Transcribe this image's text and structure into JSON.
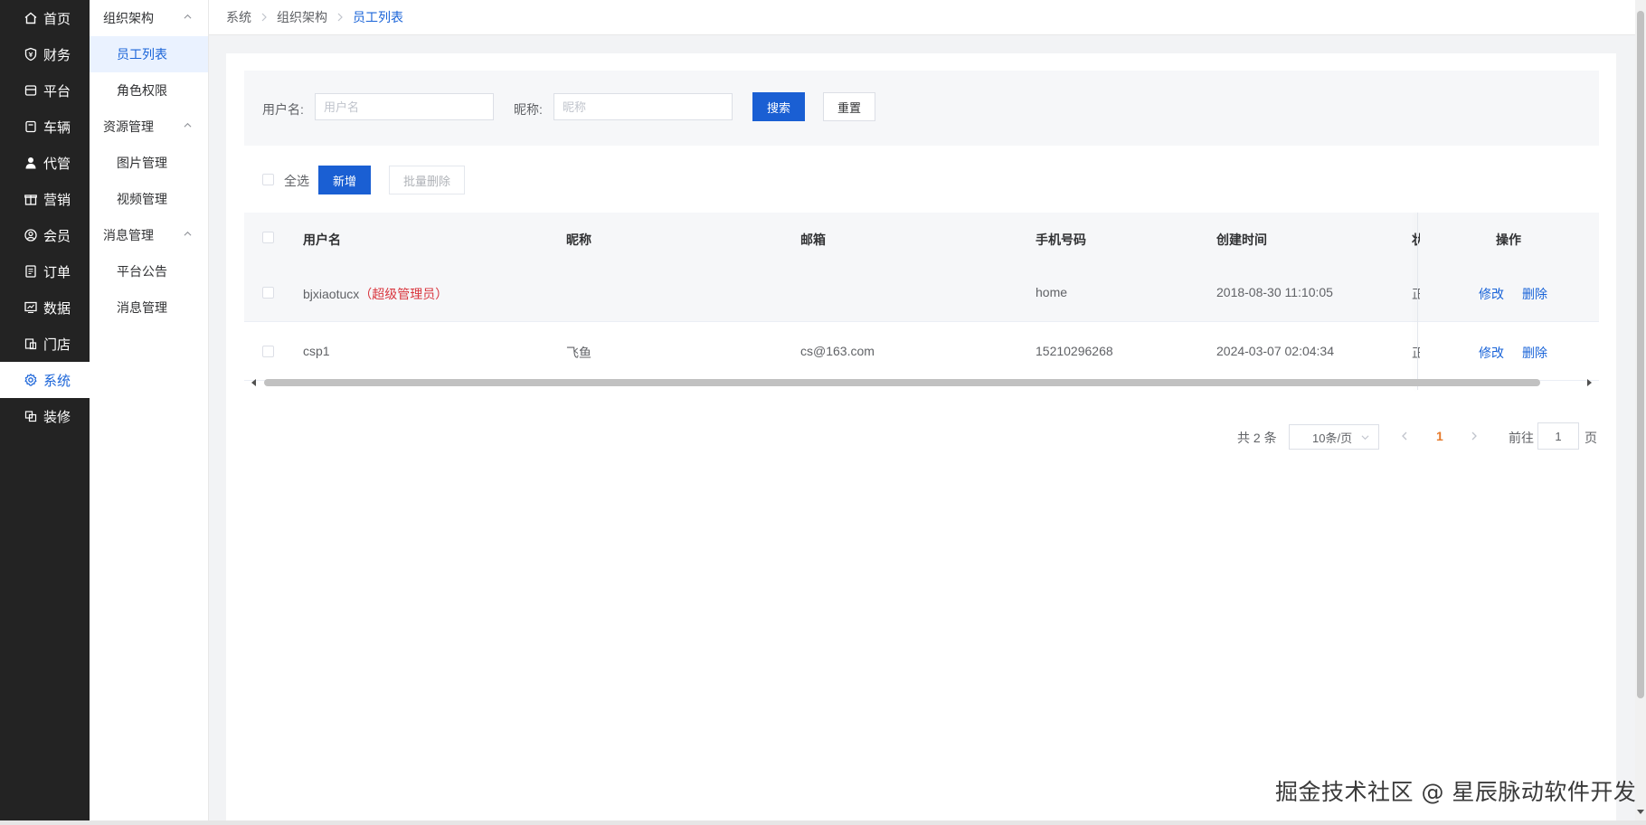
{
  "primary_nav": [
    {
      "label": "首页",
      "icon": "home-icon"
    },
    {
      "label": "财务",
      "icon": "finance-shield-icon"
    },
    {
      "label": "平台",
      "icon": "platform-icon"
    },
    {
      "label": "车辆",
      "icon": "vehicle-icon"
    },
    {
      "label": "代管",
      "icon": "agent-person-icon"
    },
    {
      "label": "营销",
      "icon": "gift-icon"
    },
    {
      "label": "会员",
      "icon": "member-icon"
    },
    {
      "label": "订单",
      "icon": "order-icon"
    },
    {
      "label": "数据",
      "icon": "data-chart-icon"
    },
    {
      "label": "门店",
      "icon": "store-icon"
    },
    {
      "label": "系统",
      "icon": "gear-icon",
      "active": true
    },
    {
      "label": "装修",
      "icon": "decoration-icon"
    }
  ],
  "secondary_nav": {
    "groups": [
      {
        "label": "组织架构",
        "items": [
          "员工列表",
          "角色权限"
        ]
      },
      {
        "label": "资源管理",
        "items": [
          "图片管理",
          "视频管理"
        ]
      },
      {
        "label": "消息管理",
        "items": [
          "平台公告",
          "消息管理"
        ]
      }
    ],
    "active_item": "员工列表"
  },
  "breadcrumb": [
    "系统",
    "组织架构",
    "员工列表"
  ],
  "filter": {
    "username_label": "用户名:",
    "username_placeholder": "用户名",
    "nickname_label": "昵称:",
    "nickname_placeholder": "昵称",
    "search_label": "搜索",
    "reset_label": "重置"
  },
  "toolbar": {
    "select_all_label": "全选",
    "add_label": "新增",
    "batch_delete_label": "批量删除"
  },
  "table": {
    "columns": [
      "用户名",
      "昵称",
      "邮箱",
      "手机号码",
      "创建时间",
      "状",
      "操作"
    ],
    "rows": [
      {
        "username": "bjxiaotucx",
        "tag": "（超级管理员）",
        "nickname": "",
        "email": "",
        "phone": "home",
        "created": "2018-08-30 11:10:05",
        "status_cut": "正"
      },
      {
        "username": "csp1",
        "tag": "",
        "nickname": "飞鱼",
        "email": "cs@163.com",
        "phone": "15210296268",
        "created": "2024-03-07 02:04:34",
        "status_cut": "正"
      }
    ],
    "edit_label": "修改",
    "delete_label": "删除"
  },
  "pagination": {
    "total_text": "共 2 条",
    "page_size": "10条/页",
    "current_page": "1",
    "goto_label": "前往",
    "goto_value": "1",
    "page_suffix": "页"
  },
  "watermark": "掘金技术社区 @ 星辰脉动软件开发",
  "colors": {
    "primary": "#1a5fd3",
    "sidebar_bg": "#232323",
    "danger_tag": "#d9363e",
    "current_page": "#e6792a"
  }
}
